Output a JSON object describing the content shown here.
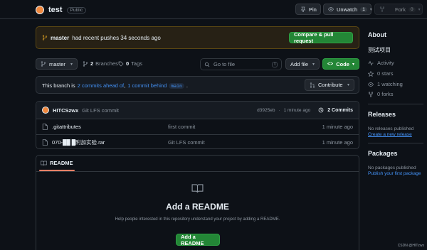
{
  "repo": {
    "name": "test",
    "visibility": "Public"
  },
  "header_actions": {
    "pin": "Pin",
    "unwatch": "Unwatch",
    "unwatch_count": "1",
    "fork": "Fork",
    "fork_count": "0"
  },
  "push_banner": {
    "branch": "master",
    "message": "had recent pushes 34 seconds ago",
    "button": "Compare & pull request"
  },
  "toolbar": {
    "branch": "master",
    "branches_count": "2",
    "branches_label": "Branches",
    "tags_count": "0",
    "tags_label": "Tags",
    "search_placeholder": "Go to file",
    "search_shortcut": "t",
    "add_file": "Add file",
    "code": "Code"
  },
  "branch_status": {
    "prefix": "This branch is",
    "ahead": "2 commits ahead of",
    "sep": ",",
    "behind": "1 commit behind",
    "target": "main",
    "suffix": ".",
    "contribute": "Contribute"
  },
  "latest_commit": {
    "author": "HITCSzwx",
    "message": "Git LFS commit",
    "hash": "d3925eb",
    "sep": "·",
    "time": "1 minute ago",
    "commits_label": "2 Commits"
  },
  "files": [
    {
      "name": ".gitattributes",
      "commit": "first commit",
      "time": "1 minute ago"
    },
    {
      "name": "070-██  █附加实验.rar",
      "commit": "Git LFS commit",
      "time": "1 minute ago"
    }
  ],
  "readme": {
    "tab": "README",
    "title": "Add a README",
    "description": "Help people interested in this repository understand your project by adding a README.",
    "button": "Add a README"
  },
  "sidebar": {
    "about_title": "About",
    "description": "测试项目",
    "stats": [
      {
        "icon": "pulse-icon",
        "label": "Activity"
      },
      {
        "icon": "star-icon",
        "label": "0 stars"
      },
      {
        "icon": "eye-icon",
        "label": "1 watching"
      },
      {
        "icon": "fork-icon",
        "label": "0 forks"
      }
    ],
    "releases_title": "Releases",
    "releases_empty": "No releases published",
    "releases_link": "Create a new release",
    "packages_title": "Packages",
    "packages_empty": "No packages published",
    "packages_link": "Publish your first package"
  },
  "watermark": "CSDN @HITzwx",
  "colors": {
    "accent_green": "#238636",
    "link_blue": "#4493f8",
    "banner_bg": "#272115",
    "background": "#0d1117"
  }
}
